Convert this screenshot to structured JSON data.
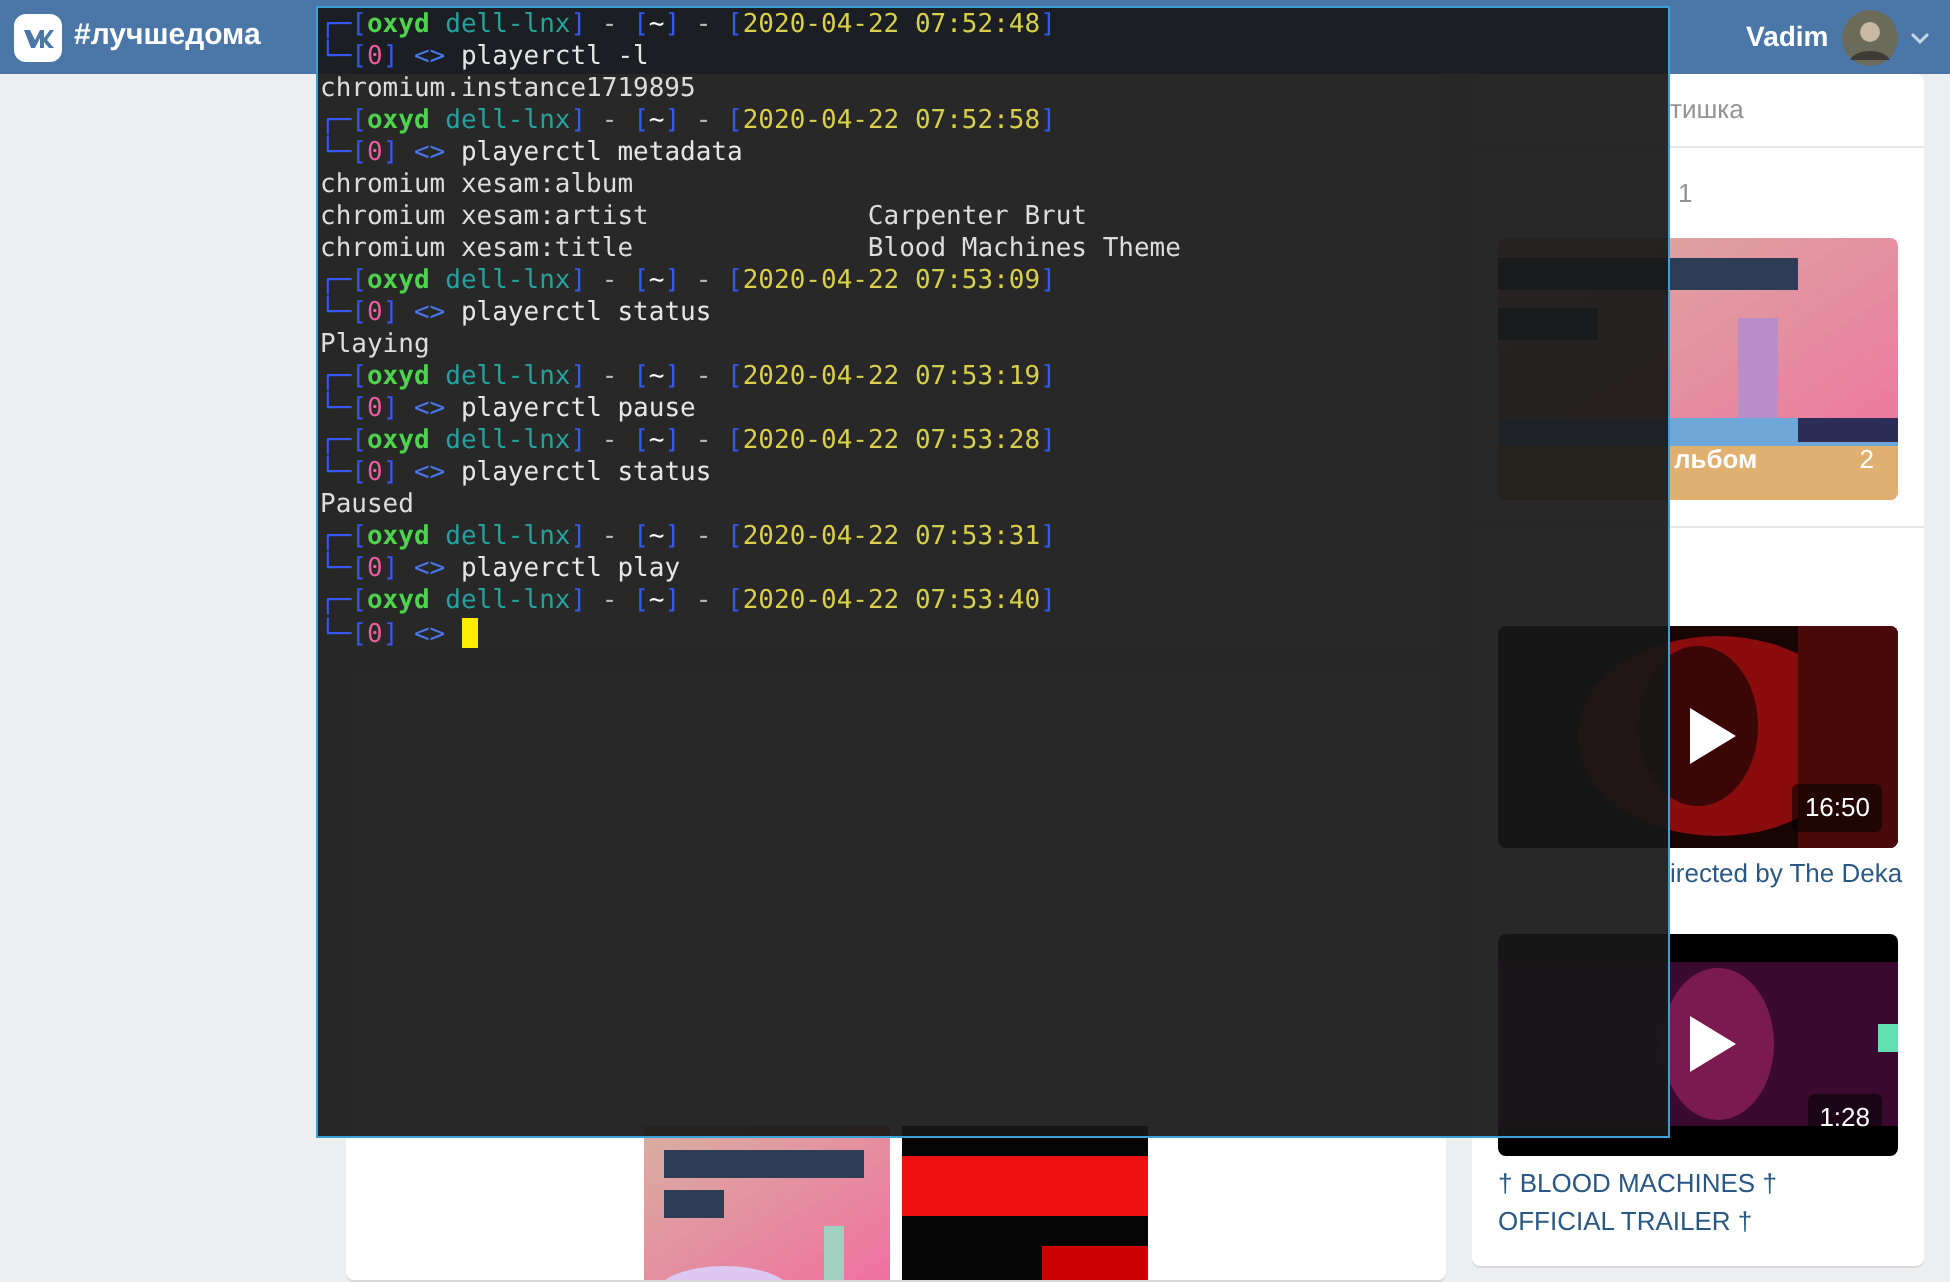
{
  "header": {
    "title": "#лучшедома",
    "user_name": "Vadim"
  },
  "sidebar": {
    "contact_name": "тишка",
    "albums": {
      "count": "1",
      "items": [
        {
          "name": "льбом",
          "count": "2"
        }
      ]
    },
    "videos": {
      "items": [
        {
          "duration": "16:50",
          "title": "irected by The Deka"
        },
        {
          "duration": "1:28",
          "title": "† BLOOD MACHINES † OFFICIAL TRAILER †"
        }
      ]
    }
  },
  "terminal": {
    "lines": [
      {
        "kind": "prompt",
        "segments": [
          {
            "kind": "frame",
            "text": "┌─["
          },
          {
            "kind": "user",
            "text": "oxyd"
          },
          {
            "kind": "host",
            "text": " dell-lnx"
          },
          {
            "kind": "frame",
            "text": "]"
          },
          {
            "kind": "dash",
            "text": " - "
          },
          {
            "kind": "frame",
            "text": "["
          },
          {
            "kind": "dir",
            "text": "~"
          },
          {
            "kind": "frame",
            "text": "]"
          },
          {
            "kind": "dash",
            "text": " - "
          },
          {
            "kind": "frame",
            "text": "["
          },
          {
            "kind": "time",
            "text": "2020-04-22 07:52:48"
          },
          {
            "kind": "frame",
            "text": "]"
          }
        ],
        "segments2": [
          {
            "kind": "frame",
            "text": "└─["
          },
          {
            "kind": "code",
            "text": "0"
          },
          {
            "kind": "frame",
            "text": "]"
          },
          {
            "kind": "arrow",
            "text": " <>"
          },
          {
            "kind": "command",
            "text": " playerctl -l"
          }
        ],
        "cursor": false
      },
      {
        "kind": "output",
        "text": "chromium.instance1719895"
      },
      {
        "kind": "prompt",
        "segments": [
          {
            "kind": "frame",
            "text": "┌─["
          },
          {
            "kind": "user",
            "text": "oxyd"
          },
          {
            "kind": "host",
            "text": " dell-lnx"
          },
          {
            "kind": "frame",
            "text": "]"
          },
          {
            "kind": "dash",
            "text": " - "
          },
          {
            "kind": "frame",
            "text": "["
          },
          {
            "kind": "dir",
            "text": "~"
          },
          {
            "kind": "frame",
            "text": "]"
          },
          {
            "kind": "dash",
            "text": " - "
          },
          {
            "kind": "frame",
            "text": "["
          },
          {
            "kind": "time",
            "text": "2020-04-22 07:52:58"
          },
          {
            "kind": "frame",
            "text": "]"
          }
        ],
        "segments2": [
          {
            "kind": "frame",
            "text": "└─["
          },
          {
            "kind": "code",
            "text": "0"
          },
          {
            "kind": "frame",
            "text": "]"
          },
          {
            "kind": "arrow",
            "text": " <>"
          },
          {
            "kind": "command",
            "text": " playerctl metadata"
          }
        ],
        "cursor": false
      },
      {
        "kind": "output",
        "text": "chromium xesam:album"
      },
      {
        "kind": "output",
        "text": "chromium xesam:artist",
        "value": "Carpenter Brut"
      },
      {
        "kind": "output",
        "text": "chromium xesam:title",
        "value": "Blood Machines Theme"
      },
      {
        "kind": "prompt",
        "segments": [
          {
            "kind": "frame",
            "text": "┌─["
          },
          {
            "kind": "user",
            "text": "oxyd"
          },
          {
            "kind": "host",
            "text": " dell-lnx"
          },
          {
            "kind": "frame",
            "text": "]"
          },
          {
            "kind": "dash",
            "text": " - "
          },
          {
            "kind": "frame",
            "text": "["
          },
          {
            "kind": "dir",
            "text": "~"
          },
          {
            "kind": "frame",
            "text": "]"
          },
          {
            "kind": "dash",
            "text": " - "
          },
          {
            "kind": "frame",
            "text": "["
          },
          {
            "kind": "time",
            "text": "2020-04-22 07:53:09"
          },
          {
            "kind": "frame",
            "text": "]"
          }
        ],
        "segments2": [
          {
            "kind": "frame",
            "text": "└─["
          },
          {
            "kind": "code",
            "text": "0"
          },
          {
            "kind": "frame",
            "text": "]"
          },
          {
            "kind": "arrow",
            "text": " <>"
          },
          {
            "kind": "command",
            "text": " playerctl status"
          }
        ],
        "cursor": false
      },
      {
        "kind": "output",
        "text": "Playing"
      },
      {
        "kind": "prompt",
        "segments": [
          {
            "kind": "frame",
            "text": "┌─["
          },
          {
            "kind": "user",
            "text": "oxyd"
          },
          {
            "kind": "host",
            "text": " dell-lnx"
          },
          {
            "kind": "frame",
            "text": "]"
          },
          {
            "kind": "dash",
            "text": " - "
          },
          {
            "kind": "frame",
            "text": "["
          },
          {
            "kind": "dir",
            "text": "~"
          },
          {
            "kind": "frame",
            "text": "]"
          },
          {
            "kind": "dash",
            "text": " - "
          },
          {
            "kind": "frame",
            "text": "["
          },
          {
            "kind": "time",
            "text": "2020-04-22 07:53:19"
          },
          {
            "kind": "frame",
            "text": "]"
          }
        ],
        "segments2": [
          {
            "kind": "frame",
            "text": "└─["
          },
          {
            "kind": "code",
            "text": "0"
          },
          {
            "kind": "frame",
            "text": "]"
          },
          {
            "kind": "arrow",
            "text": " <>"
          },
          {
            "kind": "command",
            "text": " playerctl pause"
          }
        ],
        "cursor": false
      },
      {
        "kind": "prompt",
        "segments": [
          {
            "kind": "frame",
            "text": "┌─["
          },
          {
            "kind": "user",
            "text": "oxyd"
          },
          {
            "kind": "host",
            "text": " dell-lnx"
          },
          {
            "kind": "frame",
            "text": "]"
          },
          {
            "kind": "dash",
            "text": " - "
          },
          {
            "kind": "frame",
            "text": "["
          },
          {
            "kind": "dir",
            "text": "~"
          },
          {
            "kind": "frame",
            "text": "]"
          },
          {
            "kind": "dash",
            "text": " - "
          },
          {
            "kind": "frame",
            "text": "["
          },
          {
            "kind": "time",
            "text": "2020-04-22 07:53:28"
          },
          {
            "kind": "frame",
            "text": "]"
          }
        ],
        "segments2": [
          {
            "kind": "frame",
            "text": "└─["
          },
          {
            "kind": "code",
            "text": "0"
          },
          {
            "kind": "frame",
            "text": "]"
          },
          {
            "kind": "arrow",
            "text": " <>"
          },
          {
            "kind": "command",
            "text": " playerctl status"
          }
        ],
        "cursor": false
      },
      {
        "kind": "output",
        "text": "Paused"
      },
      {
        "kind": "prompt",
        "segments": [
          {
            "kind": "frame",
            "text": "┌─["
          },
          {
            "kind": "user",
            "text": "oxyd"
          },
          {
            "kind": "host",
            "text": " dell-lnx"
          },
          {
            "kind": "frame",
            "text": "]"
          },
          {
            "kind": "dash",
            "text": " - "
          },
          {
            "kind": "frame",
            "text": "["
          },
          {
            "kind": "dir",
            "text": "~"
          },
          {
            "kind": "frame",
            "text": "]"
          },
          {
            "kind": "dash",
            "text": " - "
          },
          {
            "kind": "frame",
            "text": "["
          },
          {
            "kind": "time",
            "text": "2020-04-22 07:53:31"
          },
          {
            "kind": "frame",
            "text": "]"
          }
        ],
        "segments2": [
          {
            "kind": "frame",
            "text": "└─["
          },
          {
            "kind": "code",
            "text": "0"
          },
          {
            "kind": "frame",
            "text": "]"
          },
          {
            "kind": "arrow",
            "text": " <>"
          },
          {
            "kind": "command",
            "text": " playerctl play"
          }
        ],
        "cursor": false
      },
      {
        "kind": "prompt",
        "segments": [
          {
            "kind": "frame",
            "text": "┌─["
          },
          {
            "kind": "user",
            "text": "oxyd"
          },
          {
            "kind": "host",
            "text": " dell-lnx"
          },
          {
            "kind": "frame",
            "text": "]"
          },
          {
            "kind": "dash",
            "text": " - "
          },
          {
            "kind": "frame",
            "text": "["
          },
          {
            "kind": "dir",
            "text": "~"
          },
          {
            "kind": "frame",
            "text": "]"
          },
          {
            "kind": "dash",
            "text": " - "
          },
          {
            "kind": "frame",
            "text": "["
          },
          {
            "kind": "time",
            "text": "2020-04-22 07:53:40"
          },
          {
            "kind": "frame",
            "text": "]"
          }
        ],
        "segments2": [
          {
            "kind": "frame",
            "text": "└─["
          },
          {
            "kind": "code",
            "text": "0"
          },
          {
            "kind": "frame",
            "text": "]"
          },
          {
            "kind": "arrow",
            "text": " <>"
          }
        ],
        "cursor": true
      }
    ]
  }
}
